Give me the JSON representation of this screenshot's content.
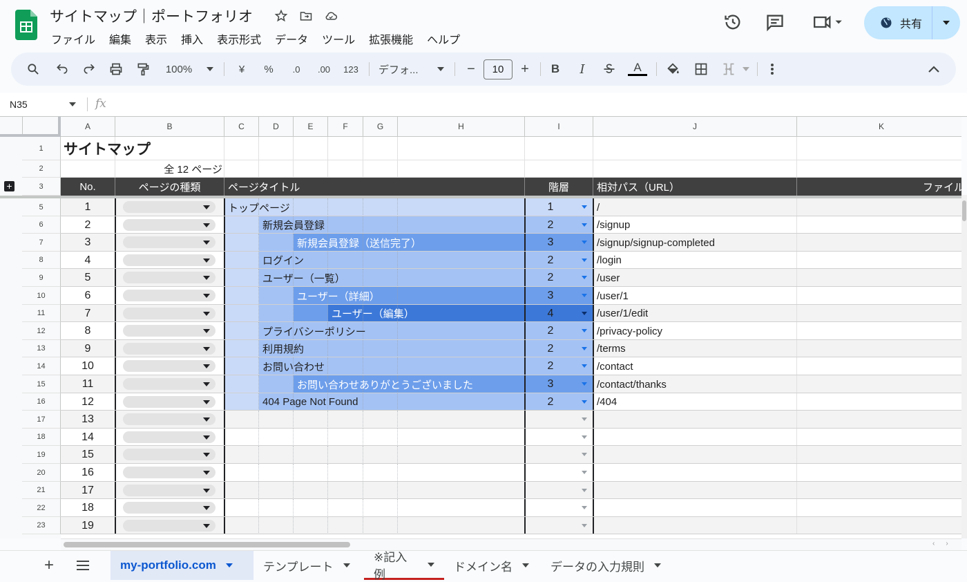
{
  "app": {
    "doc_title": "サイトマップ｜ポートフォリオ",
    "menu": [
      "ファイル",
      "編集",
      "表示",
      "挿入",
      "表示形式",
      "データ",
      "ツール",
      "拡張機能",
      "ヘルプ"
    ],
    "share_label": "共有"
  },
  "toolbar": {
    "zoom": "100%",
    "currency": "¥",
    "percent": "%",
    "dec_decrease": ".0",
    "dec_increase": ".00",
    "number_format": "123",
    "font_name": "デフォ...",
    "font_size": "10",
    "minus": "−",
    "plus": "+",
    "bold": "B",
    "italic": "I",
    "underline_text": "A"
  },
  "formula_bar": {
    "cell_ref": "N35",
    "fx": "fx"
  },
  "columns": [
    "A",
    "B",
    "C",
    "D",
    "E",
    "F",
    "G",
    "H",
    "I",
    "J",
    "K"
  ],
  "sheet": {
    "title": "サイトマップ",
    "total": "全 12 ページ",
    "headers": {
      "no": "No.",
      "type": "ページの種類",
      "title": "ページタイトル",
      "level": "階層",
      "path": "相対パス（URL）",
      "file": "ファイル名"
    },
    "rows": [
      {
        "row": "5",
        "no": "1",
        "title": "トップページ",
        "level": "1",
        "path": "/"
      },
      {
        "row": "6",
        "no": "2",
        "title": "新規会員登録",
        "level": "2",
        "path": "/signup"
      },
      {
        "row": "7",
        "no": "3",
        "title": "新規会員登録（送信完了）",
        "level": "3",
        "path": "/signup/signup-completed"
      },
      {
        "row": "8",
        "no": "4",
        "title": "ログイン",
        "level": "2",
        "path": "/login"
      },
      {
        "row": "9",
        "no": "5",
        "title": "ユーザー（一覧）",
        "level": "2",
        "path": "/user"
      },
      {
        "row": "10",
        "no": "6",
        "title": "ユーザー（詳細）",
        "level": "3",
        "path": "/user/1"
      },
      {
        "row": "11",
        "no": "7",
        "title": "ユーザー（編集）",
        "level": "4",
        "path": "/user/1/edit"
      },
      {
        "row": "12",
        "no": "8",
        "title": "プライバシーポリシー",
        "level": "2",
        "path": "/privacy-policy"
      },
      {
        "row": "13",
        "no": "9",
        "title": "利用規約",
        "level": "2",
        "path": "/terms"
      },
      {
        "row": "14",
        "no": "10",
        "title": "お問い合わせ",
        "level": "2",
        "path": "/contact"
      },
      {
        "row": "15",
        "no": "11",
        "title": "お問い合わせありがとうございました",
        "level": "3",
        "path": "/contact/thanks"
      },
      {
        "row": "16",
        "no": "12",
        "title": "404 Page Not Found",
        "level": "2",
        "path": "/404"
      },
      {
        "row": "17",
        "no": "13",
        "title": "",
        "level": "",
        "path": ""
      },
      {
        "row": "18",
        "no": "14",
        "title": "",
        "level": "",
        "path": ""
      },
      {
        "row": "19",
        "no": "15",
        "title": "",
        "level": "",
        "path": ""
      },
      {
        "row": "20",
        "no": "16",
        "title": "",
        "level": "",
        "path": ""
      },
      {
        "row": "21",
        "no": "17",
        "title": "",
        "level": "",
        "path": ""
      },
      {
        "row": "22",
        "no": "18",
        "title": "",
        "level": "",
        "path": ""
      },
      {
        "row": "23",
        "no": "19",
        "title": "",
        "level": "",
        "path": ""
      }
    ],
    "top_rows": [
      "1",
      "2",
      "3"
    ]
  },
  "tabs": [
    {
      "label": "my-portfolio.com",
      "active": true
    },
    {
      "label": "テンプレート",
      "active": false
    },
    {
      "label": "※記入例",
      "active": false
    },
    {
      "label": "ドメイン名",
      "active": false
    },
    {
      "label": "データの入力規則",
      "active": false
    }
  ],
  "colors": {
    "header_dark": "#404040",
    "level1": "#c9daf8",
    "level2": "#a4c2f4",
    "level3": "#6d9eeb",
    "level4": "#3c78d8",
    "share_bg": "#c2e7ff",
    "accent": "#0b57d0"
  }
}
